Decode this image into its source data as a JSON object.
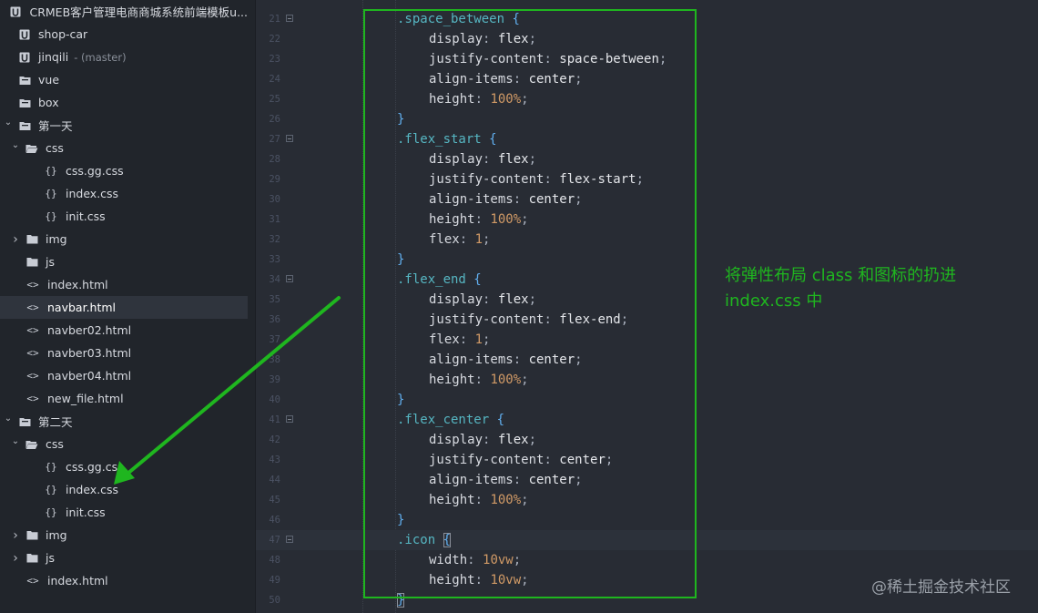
{
  "sidebar": {
    "items": [
      {
        "label": "CRMEB客户管理电商商城系统前端模板u...",
        "icon": "project-icon",
        "chevron": "none",
        "extra": ""
      },
      {
        "label": "shop-car",
        "icon": "project-icon",
        "chevron": "none",
        "extra": ""
      },
      {
        "label": "jinqili",
        "icon": "project-icon",
        "chevron": "none",
        "extra": "- (master)"
      },
      {
        "label": "vue",
        "icon": "folder-box-icon",
        "chevron": "none",
        "extra": ""
      },
      {
        "label": "box",
        "icon": "folder-box-icon",
        "chevron": "none",
        "extra": ""
      },
      {
        "label": "第一天",
        "icon": "folder-box-icon",
        "chevron": "expanded",
        "extra": ""
      },
      {
        "label": "css",
        "icon": "folder-open-icon",
        "chevron": "expanded",
        "extra": ""
      },
      {
        "label": "css.gg.css",
        "icon": "css-file-icon",
        "chevron": "none",
        "extra": ""
      },
      {
        "label": "index.css",
        "icon": "css-file-icon",
        "chevron": "none",
        "extra": ""
      },
      {
        "label": "init.css",
        "icon": "css-file-icon",
        "chevron": "none",
        "extra": ""
      },
      {
        "label": "img",
        "icon": "folder-icon",
        "chevron": "collapsed",
        "extra": ""
      },
      {
        "label": "js",
        "icon": "folder-icon",
        "chevron": "none",
        "extra": ""
      },
      {
        "label": "index.html",
        "icon": "html-file-icon",
        "chevron": "none",
        "extra": ""
      },
      {
        "label": "navbar.html",
        "icon": "html-file-icon",
        "chevron": "none",
        "extra": "",
        "selected": true
      },
      {
        "label": "navber02.html",
        "icon": "html-file-icon",
        "chevron": "none",
        "extra": ""
      },
      {
        "label": "navber03.html",
        "icon": "html-file-icon",
        "chevron": "none",
        "extra": ""
      },
      {
        "label": "navber04.html",
        "icon": "html-file-icon",
        "chevron": "none",
        "extra": ""
      },
      {
        "label": "new_file.html",
        "icon": "html-file-icon",
        "chevron": "none",
        "extra": ""
      },
      {
        "label": "第二天",
        "icon": "folder-box-icon",
        "chevron": "expanded",
        "extra": ""
      },
      {
        "label": "css",
        "icon": "folder-open-icon",
        "chevron": "expanded",
        "extra": ""
      },
      {
        "label": "css.gg.css",
        "icon": "css-file-icon",
        "chevron": "none",
        "extra": ""
      },
      {
        "label": "index.css",
        "icon": "css-file-icon",
        "chevron": "none",
        "extra": ""
      },
      {
        "label": "init.css",
        "icon": "css-file-icon",
        "chevron": "none",
        "extra": ""
      },
      {
        "label": "img",
        "icon": "folder-icon",
        "chevron": "collapsed",
        "extra": ""
      },
      {
        "label": "js",
        "icon": "folder-icon",
        "chevron": "collapsed",
        "extra": ""
      },
      {
        "label": "index.html",
        "icon": "html-file-icon",
        "chevron": "none",
        "extra": ""
      }
    ]
  },
  "editor": {
    "lines": [
      {
        "num": "21",
        "fold": true,
        "active": false,
        "tokens": [
          [
            "sel",
            ".space_between "
          ],
          [
            "brace",
            "{"
          ]
        ]
      },
      {
        "num": "22",
        "fold": false,
        "active": false,
        "tokens": [
          [
            "prop",
            "display"
          ],
          [
            "punc",
            ": "
          ],
          [
            "val",
            "flex"
          ],
          [
            "punc",
            ";"
          ]
        ]
      },
      {
        "num": "23",
        "fold": false,
        "active": false,
        "tokens": [
          [
            "prop",
            "justify-content"
          ],
          [
            "punc",
            ": "
          ],
          [
            "val",
            "space-between"
          ],
          [
            "punc",
            ";"
          ]
        ]
      },
      {
        "num": "24",
        "fold": false,
        "active": false,
        "tokens": [
          [
            "prop",
            "align-items"
          ],
          [
            "punc",
            ": "
          ],
          [
            "val",
            "center"
          ],
          [
            "punc",
            ";"
          ]
        ]
      },
      {
        "num": "25",
        "fold": false,
        "active": false,
        "tokens": [
          [
            "prop",
            "height"
          ],
          [
            "punc",
            ": "
          ],
          [
            "num",
            "100%"
          ],
          [
            "punc",
            ";"
          ]
        ]
      },
      {
        "num": "26",
        "fold": false,
        "active": false,
        "tokens": [
          [
            "brace",
            "}"
          ]
        ]
      },
      {
        "num": "27",
        "fold": true,
        "active": false,
        "tokens": [
          [
            "sel",
            ".flex_start "
          ],
          [
            "brace",
            "{"
          ]
        ]
      },
      {
        "num": "28",
        "fold": false,
        "active": false,
        "tokens": [
          [
            "prop",
            "display"
          ],
          [
            "punc",
            ": "
          ],
          [
            "val",
            "flex"
          ],
          [
            "punc",
            ";"
          ]
        ]
      },
      {
        "num": "29",
        "fold": false,
        "active": false,
        "tokens": [
          [
            "prop",
            "justify-content"
          ],
          [
            "punc",
            ": "
          ],
          [
            "val",
            "flex-start"
          ],
          [
            "punc",
            ";"
          ]
        ]
      },
      {
        "num": "30",
        "fold": false,
        "active": false,
        "tokens": [
          [
            "prop",
            "align-items"
          ],
          [
            "punc",
            ": "
          ],
          [
            "val",
            "center"
          ],
          [
            "punc",
            ";"
          ]
        ]
      },
      {
        "num": "31",
        "fold": false,
        "active": false,
        "tokens": [
          [
            "prop",
            "height"
          ],
          [
            "punc",
            ": "
          ],
          [
            "num",
            "100%"
          ],
          [
            "punc",
            ";"
          ]
        ]
      },
      {
        "num": "32",
        "fold": false,
        "active": false,
        "tokens": [
          [
            "prop",
            "flex"
          ],
          [
            "punc",
            ": "
          ],
          [
            "num",
            "1"
          ],
          [
            "punc",
            ";"
          ]
        ]
      },
      {
        "num": "33",
        "fold": false,
        "active": false,
        "tokens": [
          [
            "brace",
            "}"
          ]
        ]
      },
      {
        "num": "34",
        "fold": true,
        "active": false,
        "tokens": [
          [
            "sel",
            ".flex_end "
          ],
          [
            "brace",
            "{"
          ]
        ]
      },
      {
        "num": "35",
        "fold": false,
        "active": false,
        "tokens": [
          [
            "prop",
            "display"
          ],
          [
            "punc",
            ": "
          ],
          [
            "val",
            "flex"
          ],
          [
            "punc",
            ";"
          ]
        ]
      },
      {
        "num": "36",
        "fold": false,
        "active": false,
        "tokens": [
          [
            "prop",
            "justify-content"
          ],
          [
            "punc",
            ": "
          ],
          [
            "val",
            "flex-end"
          ],
          [
            "punc",
            ";"
          ]
        ]
      },
      {
        "num": "37",
        "fold": false,
        "active": false,
        "tokens": [
          [
            "prop",
            "flex"
          ],
          [
            "punc",
            ": "
          ],
          [
            "num",
            "1"
          ],
          [
            "punc",
            ";"
          ]
        ]
      },
      {
        "num": "38",
        "fold": false,
        "active": false,
        "tokens": [
          [
            "prop",
            "align-items"
          ],
          [
            "punc",
            ": "
          ],
          [
            "val",
            "center"
          ],
          [
            "punc",
            ";"
          ]
        ]
      },
      {
        "num": "39",
        "fold": false,
        "active": false,
        "tokens": [
          [
            "prop",
            "height"
          ],
          [
            "punc",
            ": "
          ],
          [
            "num",
            "100%"
          ],
          [
            "punc",
            ";"
          ]
        ]
      },
      {
        "num": "40",
        "fold": false,
        "active": false,
        "tokens": [
          [
            "brace",
            "}"
          ]
        ]
      },
      {
        "num": "41",
        "fold": true,
        "active": false,
        "tokens": [
          [
            "sel",
            ".flex_center "
          ],
          [
            "brace",
            "{"
          ]
        ]
      },
      {
        "num": "42",
        "fold": false,
        "active": false,
        "tokens": [
          [
            "prop",
            "display"
          ],
          [
            "punc",
            ": "
          ],
          [
            "val",
            "flex"
          ],
          [
            "punc",
            ";"
          ]
        ]
      },
      {
        "num": "43",
        "fold": false,
        "active": false,
        "tokens": [
          [
            "prop",
            "justify-content"
          ],
          [
            "punc",
            ": "
          ],
          [
            "val",
            "center"
          ],
          [
            "punc",
            ";"
          ]
        ]
      },
      {
        "num": "44",
        "fold": false,
        "active": false,
        "tokens": [
          [
            "prop",
            "align-items"
          ],
          [
            "punc",
            ": "
          ],
          [
            "val",
            "center"
          ],
          [
            "punc",
            ";"
          ]
        ]
      },
      {
        "num": "45",
        "fold": false,
        "active": false,
        "tokens": [
          [
            "prop",
            "height"
          ],
          [
            "punc",
            ": "
          ],
          [
            "num",
            "100%"
          ],
          [
            "punc",
            ";"
          ]
        ]
      },
      {
        "num": "46",
        "fold": false,
        "active": false,
        "tokens": [
          [
            "brace",
            "}"
          ]
        ]
      },
      {
        "num": "47",
        "fold": true,
        "active": true,
        "tokens": [
          [
            "sel",
            ".icon "
          ],
          [
            "brace-match",
            "{"
          ]
        ]
      },
      {
        "num": "48",
        "fold": false,
        "active": false,
        "tokens": [
          [
            "prop",
            "width"
          ],
          [
            "punc",
            ": "
          ],
          [
            "num",
            "10vw"
          ],
          [
            "punc",
            ";"
          ]
        ]
      },
      {
        "num": "49",
        "fold": false,
        "active": false,
        "tokens": [
          [
            "prop",
            "height"
          ],
          [
            "punc",
            ": "
          ],
          [
            "num",
            "10vw"
          ],
          [
            "punc",
            ";"
          ]
        ]
      },
      {
        "num": "50",
        "fold": false,
        "active": false,
        "tokens": [
          [
            "brace-match",
            "}"
          ]
        ]
      }
    ]
  },
  "annotation": {
    "line1": "将弹性布局 class 和图标的扔进",
    "line2": "index.css 中"
  },
  "watermark": "@稀土掘金技术社区",
  "colors": {
    "annotation": "#1fb61f",
    "selector": "#56b6c2",
    "number": "#d19a66",
    "brace": "#61afef"
  }
}
